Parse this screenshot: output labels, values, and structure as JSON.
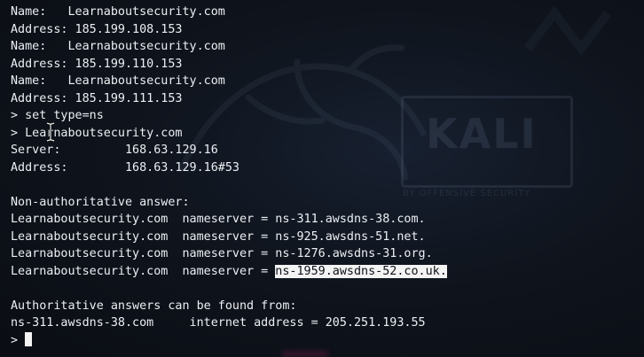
{
  "watermark": {
    "logo_text": "KALI",
    "tagline": "BY OFFENSIVE SECURITY"
  },
  "terminal": {
    "lines": [
      {
        "prefix": "",
        "text": "Name:   Learnaboutsecurity.com"
      },
      {
        "prefix": "",
        "text": "Address: 185.199.108.153"
      },
      {
        "prefix": "",
        "text": "Name:   Learnaboutsecurity.com"
      },
      {
        "prefix": "",
        "text": "Address: 185.199.110.153"
      },
      {
        "prefix": "",
        "text": "Name:   Learnaboutsecurity.com"
      },
      {
        "prefix": "",
        "text": "Address: 185.199.111.153"
      },
      {
        "prefix": "",
        "text": "> set type=ns"
      },
      {
        "prefix": "",
        "text": "> Learnaboutsecurity.com"
      },
      {
        "prefix": "",
        "text": "Server:         168.63.129.16"
      },
      {
        "prefix": "",
        "text": "Address:        168.63.129.16#53"
      },
      {
        "prefix": "",
        "text": ""
      },
      {
        "prefix": "",
        "text": "Non-authoritative answer:"
      },
      {
        "prefix": "",
        "text": "Learnaboutsecurity.com  nameserver = ns-311.awsdns-38.com."
      },
      {
        "prefix": "",
        "text": "Learnaboutsecurity.com  nameserver = ns-925.awsdns-51.net."
      },
      {
        "prefix": "",
        "text": "Learnaboutsecurity.com  nameserver = ns-1276.awsdns-31.org."
      },
      {
        "prefix": "Learnaboutsecurity.com  nameserver = ",
        "text": "ns-1959.awsdns-52.co.uk."
      },
      {
        "prefix": "",
        "text": ""
      },
      {
        "prefix": "",
        "text": "Authoritative answers can be found from:"
      },
      {
        "prefix": "",
        "text": "ns-311.awsdns-38.com     internet address = 205.251.193.55"
      }
    ],
    "prompt": "> "
  }
}
